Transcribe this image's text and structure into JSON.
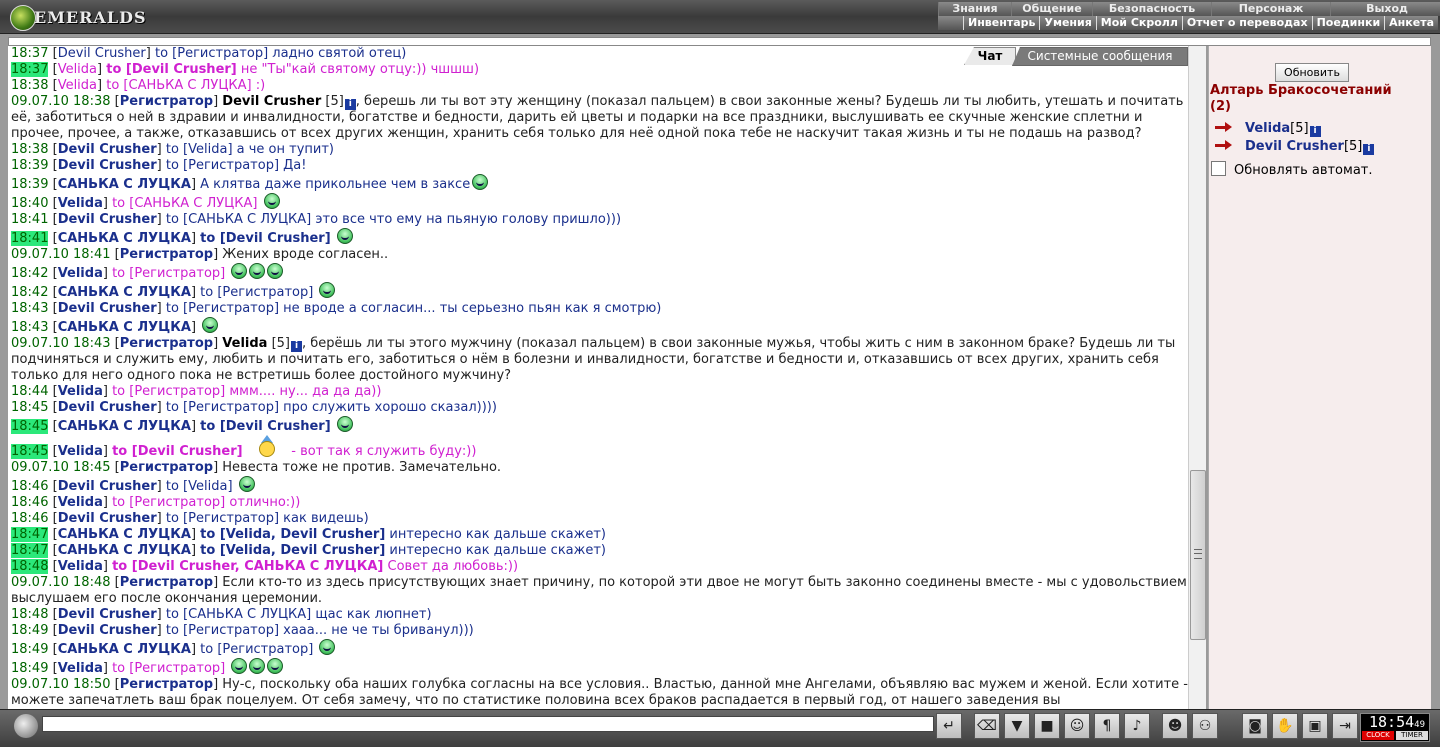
{
  "app": {
    "title": "EMERALDS"
  },
  "menu_top": [
    "Знания",
    "Общение",
    "Безопасность",
    "Персонаж",
    "Выход"
  ],
  "menu_sub": [
    "Инвентарь",
    "Умения",
    "Мой Скролл",
    "Отчет о переводах",
    "Поединки",
    "Анкета"
  ],
  "tabs": {
    "chat": "Чат",
    "system": "Системные сообщения"
  },
  "lines": [
    [
      {
        "c": "t",
        "v": "18:37"
      },
      {
        "c": "k",
        "v": " ["
      },
      {
        "c": "n",
        "v": "Devil Crusher"
      },
      {
        "c": "k",
        "v": "] "
      },
      {
        "c": "n",
        "v": "to [Регистратор] ладно святой отец)"
      }
    ],
    [
      {
        "c": "hl",
        "v": "18:37"
      },
      {
        "c": "k",
        "v": " ["
      },
      {
        "c": "m",
        "v": "Velida"
      },
      {
        "c": "k",
        "v": "] "
      },
      {
        "c": "mb",
        "v": "to [Devil Crusher]"
      },
      {
        "c": "m",
        "v": " не \"Ты\"кай святому отцу:)) чшшш)"
      }
    ],
    [
      {
        "c": "t",
        "v": "18:38"
      },
      {
        "c": "k",
        "v": " ["
      },
      {
        "c": "m",
        "v": "Velida"
      },
      {
        "c": "k",
        "v": "] "
      },
      {
        "c": "m",
        "v": "to [САНЬКА С ЛУЦКА] :)"
      }
    ],
    [
      {
        "c": "t",
        "v": "09.07.10 18:38"
      },
      {
        "c": "k",
        "v": " ["
      },
      {
        "c": "nb",
        "v": "Регистратор"
      },
      {
        "c": "k",
        "v": "] "
      },
      {
        "c": "b",
        "v": "Devil Crusher"
      },
      {
        "c": "k",
        "v": " [5]"
      },
      {
        "c": "info",
        "v": "i"
      },
      {
        "c": "k",
        "v": ", берешь ли ты вот эту женщину (показал пальцем) в свои законные жены? Будешь ли ты любить, утешать и почитать её, заботиться о ней в здравии и инвалидности, богатстве и бедности, дарить ей цветы и подарки на все праздники, выслушивать ее скучные женские сплетни и прочее, прочее, а также, отказавшись от всех других женщин, хранить себя только для неё одной пока тебе не наскучит такая жизнь и ты не подашь на развод?"
      }
    ],
    [
      {
        "c": "t",
        "v": "18:38"
      },
      {
        "c": "k",
        "v": " ["
      },
      {
        "c": "nb",
        "v": "Devil Crusher"
      },
      {
        "c": "k",
        "v": "] "
      },
      {
        "c": "n",
        "v": "to [Velida] а че он тупит)"
      }
    ],
    [
      {
        "c": "t",
        "v": "18:39"
      },
      {
        "c": "k",
        "v": " ["
      },
      {
        "c": "nb",
        "v": "Devil Crusher"
      },
      {
        "c": "k",
        "v": "] "
      },
      {
        "c": "n",
        "v": "to [Регистратор] Да!"
      }
    ],
    [
      {
        "c": "t",
        "v": "18:39"
      },
      {
        "c": "k",
        "v": " ["
      },
      {
        "c": "nb",
        "v": "САНЬКА С ЛУЦКА"
      },
      {
        "c": "k",
        "v": "] "
      },
      {
        "c": "n",
        "v": "А клятва даже прикольнее чем в заксе"
      },
      {
        "c": "sm",
        "v": ""
      }
    ],
    [
      {
        "c": "t",
        "v": "18:40"
      },
      {
        "c": "k",
        "v": " ["
      },
      {
        "c": "nb",
        "v": "Velida"
      },
      {
        "c": "k",
        "v": "] "
      },
      {
        "c": "m",
        "v": "to [САНЬКА С ЛУЦКА] "
      },
      {
        "c": "sm",
        "v": ""
      }
    ],
    [
      {
        "c": "t",
        "v": "18:41"
      },
      {
        "c": "k",
        "v": " ["
      },
      {
        "c": "nb",
        "v": "Devil Crusher"
      },
      {
        "c": "k",
        "v": "] "
      },
      {
        "c": "n",
        "v": "to [САНЬКА С ЛУЦКА] это все что ему на пьяную голову пришло)))"
      }
    ],
    [
      {
        "c": "hl",
        "v": "18:41"
      },
      {
        "c": "k",
        "v": " ["
      },
      {
        "c": "nb",
        "v": "САНЬКА С ЛУЦКА"
      },
      {
        "c": "k",
        "v": "] "
      },
      {
        "c": "nb",
        "v": "to [Devil Crusher] "
      },
      {
        "c": "sm",
        "v": ""
      }
    ],
    [
      {
        "c": "t",
        "v": "09.07.10 18:41"
      },
      {
        "c": "k",
        "v": " ["
      },
      {
        "c": "nb",
        "v": "Регистратор"
      },
      {
        "c": "k",
        "v": "] Жених вроде согласен.."
      }
    ],
    [
      {
        "c": "t",
        "v": "18:42"
      },
      {
        "c": "k",
        "v": " ["
      },
      {
        "c": "nb",
        "v": "Velida"
      },
      {
        "c": "k",
        "v": "] "
      },
      {
        "c": "m",
        "v": "to [Регистратор] "
      },
      {
        "c": "sm",
        "v": ""
      },
      {
        "c": "sm",
        "v": ""
      },
      {
        "c": "sm",
        "v": ""
      }
    ],
    [
      {
        "c": "t",
        "v": "18:42"
      },
      {
        "c": "k",
        "v": " ["
      },
      {
        "c": "nb",
        "v": "САНЬКА С ЛУЦКА"
      },
      {
        "c": "k",
        "v": "] "
      },
      {
        "c": "n",
        "v": "to [Регистратор] "
      },
      {
        "c": "sm",
        "v": ""
      }
    ],
    [
      {
        "c": "t",
        "v": "18:43"
      },
      {
        "c": "k",
        "v": " ["
      },
      {
        "c": "nb",
        "v": "Devil Crusher"
      },
      {
        "c": "k",
        "v": "] "
      },
      {
        "c": "n",
        "v": "to [Регистратор] не вроде а согласин... ты серьезно пьян как я смотрю)"
      }
    ],
    [
      {
        "c": "t",
        "v": "18:43"
      },
      {
        "c": "k",
        "v": " ["
      },
      {
        "c": "nb",
        "v": "САНЬКА С ЛУЦКА"
      },
      {
        "c": "k",
        "v": "] "
      },
      {
        "c": "sm",
        "v": ""
      }
    ],
    [
      {
        "c": "t",
        "v": "09.07.10 18:43"
      },
      {
        "c": "k",
        "v": " ["
      },
      {
        "c": "nb",
        "v": "Регистратор"
      },
      {
        "c": "k",
        "v": "] "
      },
      {
        "c": "b",
        "v": "Velida"
      },
      {
        "c": "k",
        "v": " [5]"
      },
      {
        "c": "info",
        "v": "i"
      },
      {
        "c": "k",
        "v": ", берёшь ли ты этого мужчину (показал пальцем) в свои законные мужья, чтобы жить с ним в законном браке? Будешь ли ты подчиняться и служить ему, любить и почитать его, заботиться о нём в болезни и инвалидности, богатстве и бедности и, отказавшись от всех других, хранить себя только для него одного пока не встретишь более достойного мужчину?"
      }
    ],
    [
      {
        "c": "t",
        "v": "18:44"
      },
      {
        "c": "k",
        "v": " ["
      },
      {
        "c": "nb",
        "v": "Velida"
      },
      {
        "c": "k",
        "v": "] "
      },
      {
        "c": "m",
        "v": "to [Регистратор] ммм.... ну... да да да))"
      }
    ],
    [
      {
        "c": "t",
        "v": "18:45"
      },
      {
        "c": "k",
        "v": " ["
      },
      {
        "c": "nb",
        "v": "Devil Crusher"
      },
      {
        "c": "k",
        "v": "] "
      },
      {
        "c": "n",
        "v": "to [Регистратор] про служить хорошо сказал))))"
      }
    ],
    [
      {
        "c": "hl",
        "v": "18:45"
      },
      {
        "c": "k",
        "v": " ["
      },
      {
        "c": "nb",
        "v": "САНЬКА С ЛУЦКА"
      },
      {
        "c": "k",
        "v": "] "
      },
      {
        "c": "nb",
        "v": "to [Devil Crusher] "
      },
      {
        "c": "sm",
        "v": ""
      }
    ],
    [
      {
        "c": "hl",
        "v": "18:45"
      },
      {
        "c": "k",
        "v": " ["
      },
      {
        "c": "nb",
        "v": "Velida"
      },
      {
        "c": "k",
        "v": "] "
      },
      {
        "c": "mb",
        "v": "to [Devil Crusher] "
      },
      {
        "c": "fig",
        "v": ""
      },
      {
        "c": "m",
        "v": " - вот так я служить буду:))"
      }
    ],
    [
      {
        "c": "t",
        "v": "09.07.10 18:45"
      },
      {
        "c": "k",
        "v": " ["
      },
      {
        "c": "nb",
        "v": "Регистратор"
      },
      {
        "c": "k",
        "v": "] Невеста тоже не против. Замечательно."
      }
    ],
    [
      {
        "c": "t",
        "v": "18:46"
      },
      {
        "c": "k",
        "v": " ["
      },
      {
        "c": "nb",
        "v": "Devil Crusher"
      },
      {
        "c": "k",
        "v": "] "
      },
      {
        "c": "n",
        "v": "to [Velida] "
      },
      {
        "c": "sm",
        "v": ""
      }
    ],
    [
      {
        "c": "t",
        "v": "18:46"
      },
      {
        "c": "k",
        "v": " ["
      },
      {
        "c": "nb",
        "v": "Velida"
      },
      {
        "c": "k",
        "v": "] "
      },
      {
        "c": "m",
        "v": "to [Регистратор] отлично:))"
      }
    ],
    [
      {
        "c": "t",
        "v": "18:46"
      },
      {
        "c": "k",
        "v": " ["
      },
      {
        "c": "nb",
        "v": "Devil Crusher"
      },
      {
        "c": "k",
        "v": "] "
      },
      {
        "c": "n",
        "v": "to [Регистратор] как видешь)"
      }
    ],
    [
      {
        "c": "hl",
        "v": "18:47"
      },
      {
        "c": "k",
        "v": " ["
      },
      {
        "c": "nb",
        "v": "САНЬКА С ЛУЦКА"
      },
      {
        "c": "k",
        "v": "] "
      },
      {
        "c": "nb",
        "v": "to [Velida, Devil Crusher]"
      },
      {
        "c": "n",
        "v": " интересно как дальше скажет)"
      }
    ],
    [
      {
        "c": "hl",
        "v": "18:47"
      },
      {
        "c": "k",
        "v": " ["
      },
      {
        "c": "nb",
        "v": "САНЬКА С ЛУЦКА"
      },
      {
        "c": "k",
        "v": "] "
      },
      {
        "c": "nb",
        "v": "to [Velida, Devil Crusher]"
      },
      {
        "c": "n",
        "v": " интересно как дальше скажет)"
      }
    ],
    [
      {
        "c": "hl",
        "v": "18:48"
      },
      {
        "c": "k",
        "v": " ["
      },
      {
        "c": "nb",
        "v": "Velida"
      },
      {
        "c": "k",
        "v": "] "
      },
      {
        "c": "mb",
        "v": "to [Devil Crusher, САНЬКА С ЛУЦКА]"
      },
      {
        "c": "m",
        "v": " Совет да любовь:))"
      }
    ],
    [
      {
        "c": "t",
        "v": "09.07.10 18:48"
      },
      {
        "c": "k",
        "v": " ["
      },
      {
        "c": "nb",
        "v": "Регистратор"
      },
      {
        "c": "k",
        "v": "] Если кто-то из здесь присутствующих знает причину, по которой эти двое не могут быть законно соединены вместе - мы с удовольствием выслушаем его после окончания церемонии."
      }
    ],
    [
      {
        "c": "t",
        "v": "18:48"
      },
      {
        "c": "k",
        "v": " ["
      },
      {
        "c": "nb",
        "v": "Devil Crusher"
      },
      {
        "c": "k",
        "v": "] "
      },
      {
        "c": "n",
        "v": "to [САНЬКА С ЛУЦКА] щас как люпнет)"
      }
    ],
    [
      {
        "c": "t",
        "v": "18:49"
      },
      {
        "c": "k",
        "v": " ["
      },
      {
        "c": "nb",
        "v": "Devil Crusher"
      },
      {
        "c": "k",
        "v": "] "
      },
      {
        "c": "n",
        "v": "to [Регистратор] хааа... не че ты бриванул)))"
      }
    ],
    [
      {
        "c": "t",
        "v": "18:49"
      },
      {
        "c": "k",
        "v": " ["
      },
      {
        "c": "nb",
        "v": "САНЬКА С ЛУЦКА"
      },
      {
        "c": "k",
        "v": "] "
      },
      {
        "c": "n",
        "v": "to [Регистратор] "
      },
      {
        "c": "sm",
        "v": ""
      }
    ],
    [
      {
        "c": "t",
        "v": "18:49"
      },
      {
        "c": "k",
        "v": " ["
      },
      {
        "c": "nb",
        "v": "Velida"
      },
      {
        "c": "k",
        "v": "] "
      },
      {
        "c": "m",
        "v": "to [Регистратор] "
      },
      {
        "c": "sm",
        "v": ""
      },
      {
        "c": "sm",
        "v": ""
      },
      {
        "c": "sm",
        "v": ""
      }
    ],
    [
      {
        "c": "t",
        "v": "09.07.10 18:50"
      },
      {
        "c": "k",
        "v": " ["
      },
      {
        "c": "nb",
        "v": "Регистратор"
      },
      {
        "c": "k",
        "v": "] Ну-с, поскольку оба наших голубка согласны на все условия.. Властью, данной мне Ангелами, объявляю вас мужем и женой. Если хотите - можете запечатлеть ваш брак поцелуем. От себя замечу, что по статистике половина всех браков распадается в первый год, от нашего заведения вы"
      }
    ]
  ],
  "right_panel": {
    "refresh_label": "Обновить",
    "location_title": "Алтарь Бракосочетаний",
    "location_count": "(2)",
    "players": [
      {
        "name": "Velida",
        "level": "[5]"
      },
      {
        "name": "Devil Crusher",
        "level": "[5]"
      }
    ],
    "auto_refresh_label": "Обновлять автомат."
  },
  "input": {
    "value": ""
  },
  "clock": {
    "time": "18:54",
    "seconds": "49",
    "label_clock": "CLOCK",
    "label_timer": "TIMER"
  },
  "colors": {
    "timestamp": "#006400",
    "highlight": "#2be87a",
    "name": "#1a2f8c",
    "private": "#d020d0",
    "location": "#8b0000"
  }
}
